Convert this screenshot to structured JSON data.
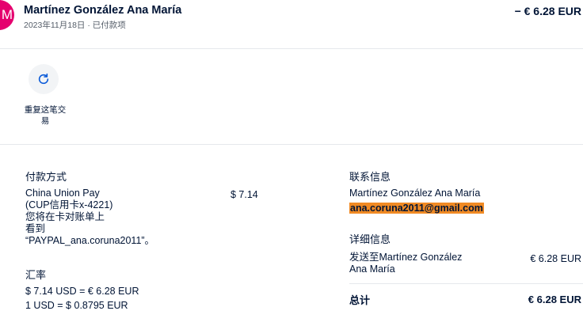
{
  "header": {
    "avatar_initial": "M",
    "name": "Martínez González Ana María",
    "subtitle": "2023年11月18日 · 已付款项",
    "amount": "− € 6.28 EUR"
  },
  "actions": {
    "repeat_label": "重复这笔交易"
  },
  "payment": {
    "heading": "付款方式",
    "lines": [
      "China Union Pay",
      "(CUP信用卡x-4221)",
      "您将在卡对账单上",
      "看到",
      "“PAYPAL_ana.coruna2011”。"
    ],
    "amount": "$ 7.14"
  },
  "exchange": {
    "heading": "汇率",
    "line1": "$ 7.14 USD = € 6.28 EUR",
    "line2": "1 USD = $ 0.8795 EUR"
  },
  "contact": {
    "heading": "联系信息",
    "name": "Martínez González Ana María",
    "email": "ana.coruna2011@gmail.com"
  },
  "details": {
    "heading": "详细信息",
    "sent_to_line1": "发送至Martínez González",
    "sent_to_line2": "Ana María",
    "sent_amount": "€ 6.28 EUR",
    "total_label": "总计",
    "total_amount": "€ 6.28 EUR"
  },
  "colors": {
    "avatar_bg": "#e5006e",
    "highlight": "#f08a24",
    "text": "#001435",
    "muted": "#545d68",
    "divider": "#e6e8ec"
  }
}
